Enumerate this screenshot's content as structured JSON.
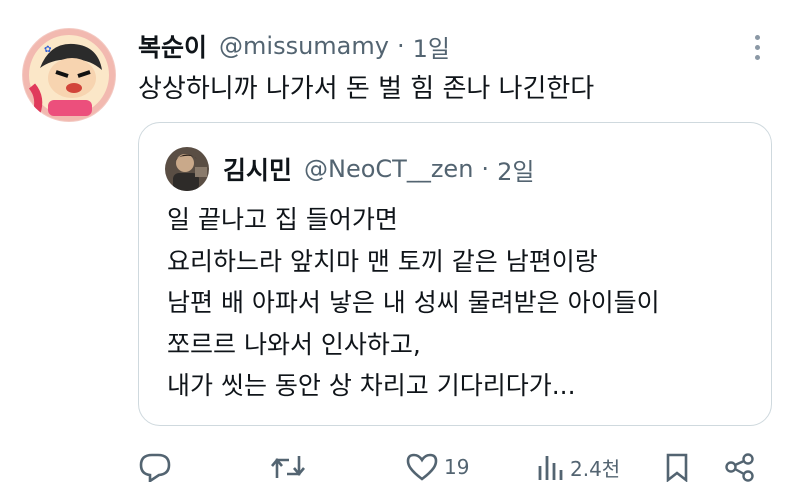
{
  "tweet": {
    "display_name": "복순이",
    "handle": "@missumamy",
    "separator": "·",
    "time": "1일",
    "text": "상상하니까 나가서 돈 벌 힘 존나 나긴한다"
  },
  "quoted_tweet": {
    "display_name": "김시민",
    "handle": "@NeoCT__zen",
    "separator": "·",
    "time": "2일",
    "lines": [
      "일 끝나고 집 들어가면",
      "요리하느라 앞치마 맨 토끼 같은 남편이랑",
      "남편 배 아파서 낳은 내 성씨 물려받은 아이들이",
      "쪼르르 나와서 인사하고,",
      "내가 씻는 동안 상 차리고 기다리다가..."
    ]
  },
  "actions": {
    "likes": "19",
    "views": "2.4천"
  },
  "icons": [
    "more-icon",
    "reply-icon",
    "retweet-icon",
    "like-icon",
    "views-icon",
    "bookmark-icon",
    "share-icon"
  ],
  "colors": {
    "text_primary": "#0f1419",
    "text_secondary": "#536471",
    "border": "#cfd9de"
  }
}
